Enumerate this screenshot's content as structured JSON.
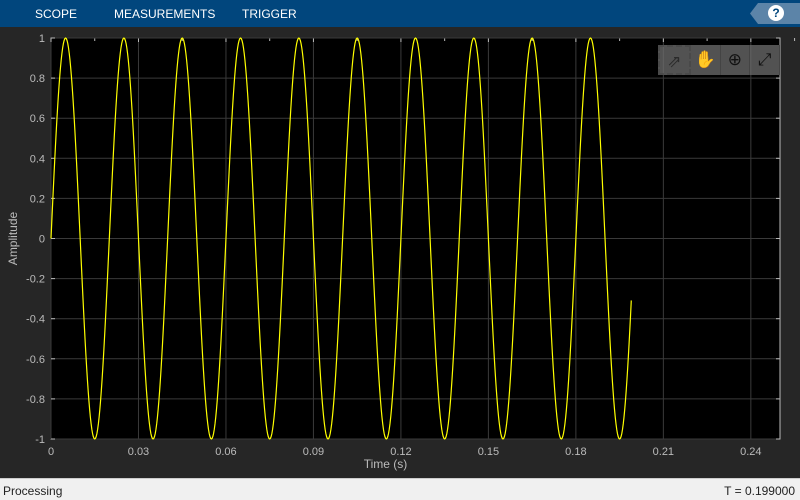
{
  "tabs": [
    "SCOPE",
    "MEASUREMENTS",
    "TRIGGER"
  ],
  "help_label": "?",
  "tools": [
    {
      "icon": "expand-arrow-icon",
      "glyph": "⇗"
    },
    {
      "icon": "pan-hand-icon",
      "glyph": "✋"
    },
    {
      "icon": "zoom-in-icon",
      "glyph": "⊕"
    },
    {
      "icon": "fit-to-view-icon",
      "glyph": "⤢"
    }
  ],
  "status": {
    "left": "Processing",
    "right": "T = 0.199000"
  },
  "chart_data": {
    "type": "line",
    "xlabel": "Time (s)",
    "ylabel": "Amplitude",
    "xlim": [
      0,
      0.25
    ],
    "ylim": [
      -1,
      1
    ],
    "xticks": [
      "0",
      "0.03",
      "0.06",
      "0.09",
      "0.12",
      "0.15",
      "0.18",
      "0.21",
      "0.24"
    ],
    "yticks": [
      "1",
      "0.8",
      "0.6",
      "0.4",
      "0.2",
      "0",
      "-0.2",
      "-0.4",
      "-0.6",
      "-0.8",
      "-1"
    ],
    "grid": true,
    "series": [
      {
        "name": "sine",
        "color": "#ffff00",
        "frequency_hz": 50,
        "amplitude": 1,
        "t_start": 0,
        "t_end": 0.199,
        "t_step": 0.001
      }
    ]
  }
}
